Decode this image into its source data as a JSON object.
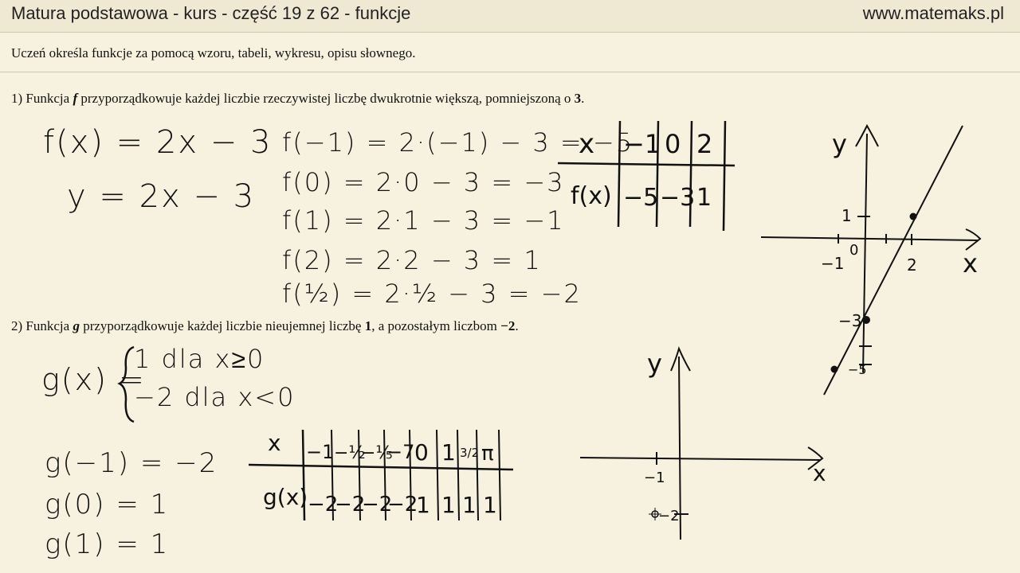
{
  "header": {
    "title": "Matura podstawowa - kurs - część 19 z 62 - funkcje",
    "site": "www.matemaks.pl"
  },
  "intro": "Uczeń określa funkcje za pomocą wzoru, tabeli, wykresu, opisu słownego.",
  "task1": {
    "prefix": "1) Funkcja ",
    "fname": "f",
    "text": " przyporządkowuje każdej liczbie rzeczywistej liczbę dwukrotnie większą, pomniejszoną o ",
    "value": "3",
    "end": "."
  },
  "task2": {
    "prefix": "2) Funkcja ",
    "fname": "g",
    "text": " przyporządkowuje każdej liczbie nieujemnej liczbę ",
    "value1": "1",
    "text2": ", a pozostałym liczbom ",
    "value2": "−2",
    "end": "."
  },
  "handwriting1": {
    "formula": "f(x) = 2x − 3",
    "y_formula": "y = 2x − 3",
    "calc": [
      "f(−1) = 2·(−1) − 3 = −5",
      "f(0) = 2·0 − 3 = −3",
      "f(1) = 2·1 − 3 = −1",
      "f(2) = 2·2 − 3 = 1",
      "f(½) = 2·½ − 3 = −2"
    ],
    "table": {
      "x_header": "x",
      "fx_header": "f(x)",
      "x": [
        "−1",
        "0",
        "2"
      ],
      "fx": [
        "−5",
        "−3",
        "1"
      ]
    },
    "graph": {
      "y_label": "y",
      "x_label": "x",
      "ticks": [
        "1",
        "0",
        "−1",
        "2",
        "−3",
        "−5"
      ]
    }
  },
  "handwriting2": {
    "g_def_name": "g(x) =",
    "g_def": [
      "1 dla x≥0",
      "−2 dla x<0"
    ],
    "values": [
      "g(−1) = −2",
      "g(0) = 1",
      "g(1) = 1"
    ],
    "table": {
      "x_header": "x",
      "gx_header": "g(x)",
      "x": [
        "−1",
        "−½",
        "−⅕",
        "−7",
        "0",
        "1",
        "3/2",
        "π"
      ],
      "gx": [
        "−2",
        "−2",
        "−2",
        "−2",
        "1",
        "1",
        "1",
        "1"
      ]
    },
    "graph": {
      "y_label": "y",
      "x_label": "x",
      "ticks": [
        "−1",
        "−2"
      ]
    }
  }
}
